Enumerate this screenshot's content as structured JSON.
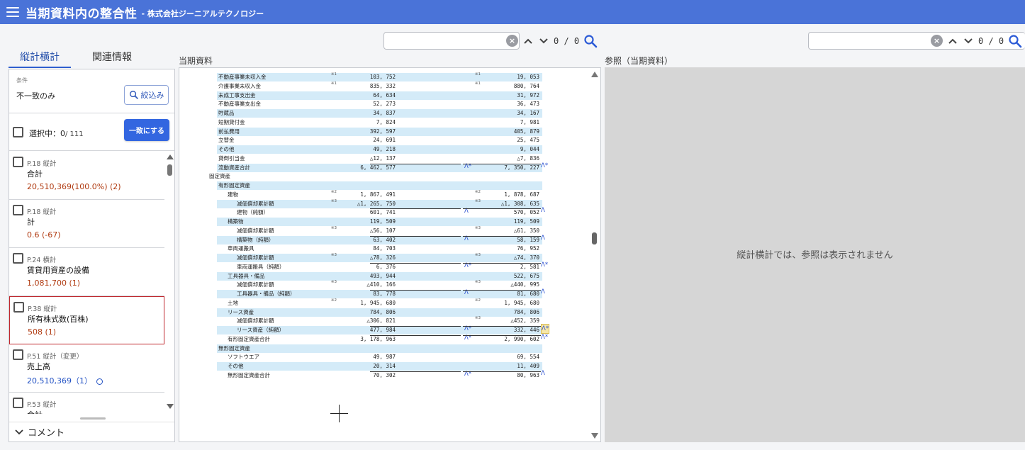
{
  "header": {
    "app_title": "当期資料内の整合性",
    "company": "- 株式会社ジーニアルテクノロジー"
  },
  "search_left": {
    "value": "",
    "count": "0 / 0"
  },
  "search_right": {
    "value": "",
    "count": "0 / 0"
  },
  "tabs": [
    {
      "label": "縦計横計",
      "active": true
    },
    {
      "label": "関連情報",
      "active": false
    }
  ],
  "filter": {
    "condition_label": "条件",
    "condition_value": "不一致のみ",
    "button_label": "絞込み"
  },
  "selection": {
    "label": "選択中：",
    "selected": "0",
    "total": "/ 111",
    "match_button": "一致にする"
  },
  "items": [
    {
      "page": "P.18 縦計",
      "name": "合計",
      "value": "20,510,369(100.0%) (2)",
      "color": "#b03a10"
    },
    {
      "page": "P.18 縦計",
      "name": "計",
      "value": "0.6 (-67)",
      "color": "#b03a10"
    },
    {
      "page": "P.24 横計",
      "name": "賃貸用資産の設備",
      "value": "1,081,700 (1)",
      "color": "#b03a10"
    },
    {
      "page": "P.38 縦計",
      "name": "所有株式数(百株)",
      "value": "508 (1)",
      "color": "#b03a10"
    },
    {
      "page": "P.51 縦計（変更）",
      "name": "売上高",
      "value": "20,510,369（1）",
      "color": "#2352c4"
    },
    {
      "page": "P.53 縦計",
      "name": "合計",
      "value": "",
      "color": "#b03a10"
    }
  ],
  "comment_label": "コメント",
  "doc_pane": {
    "label": "当期資料"
  },
  "ref_pane": {
    "label": "参照（当期資料）",
    "message": "縦計横計では、参照は表示されません"
  },
  "doc_rows": [
    {
      "label": "不動産事業未収入金",
      "indent": 0,
      "v1": "103, 752",
      "v2": "19, 053",
      "note1": "※1",
      "note2": "※1",
      "shade": true
    },
    {
      "label": "介護事業未収入金",
      "indent": 0,
      "v1": "835, 332",
      "v2": "880, 764",
      "note1": "※1",
      "note2": "※1",
      "shade": false
    },
    {
      "label": "未成工事支出金",
      "indent": 0,
      "v1": "64, 634",
      "v2": "31, 972",
      "shade": true
    },
    {
      "label": "不動産事業支出金",
      "indent": 0,
      "v1": "52, 273",
      "v2": "36, 473",
      "shade": false
    },
    {
      "label": "貯蔵品",
      "indent": 0,
      "v1": "34, 837",
      "v2": "34, 167",
      "shade": true
    },
    {
      "label": "短期貸付金",
      "indent": 0,
      "v1": "7, 824",
      "v2": "7, 981",
      "shade": false
    },
    {
      "label": "前払費用",
      "indent": 0,
      "v1": "392, 597",
      "v2": "405, 879",
      "shade": true
    },
    {
      "label": "立替金",
      "indent": 0,
      "v1": "24, 691",
      "v2": "25, 475",
      "shade": false
    },
    {
      "label": "その他",
      "indent": 0,
      "v1": "49, 218",
      "v2": "9, 044",
      "shade": true
    },
    {
      "label": "貸倒引当金",
      "indent": 0,
      "v1": "△12, 137",
      "v2": "△7, 836",
      "shade": false
    },
    {
      "label": "流動資産合計",
      "indent": 0,
      "v1": "6, 462, 577",
      "v2": "7, 350, 227",
      "m1": "Λ*",
      "m2": "Λ*",
      "shade": true
    },
    {
      "label": "固定資産",
      "indent": -1,
      "v1": "",
      "v2": "",
      "shade": false
    },
    {
      "label": "有形固定資産",
      "indent": 0,
      "v1": "",
      "v2": "",
      "shade": true
    },
    {
      "label": "建物",
      "indent": 1,
      "v1": "1, 867, 491",
      "v2": "1, 878, 687",
      "note1": "※2",
      "note2": "※2",
      "shade": false
    },
    {
      "label": "減価償却累計額",
      "indent": 2,
      "v1": "△1, 265, 750",
      "v2": "△1, 308, 635",
      "note1": "※3",
      "note2": "※3",
      "shade": true
    },
    {
      "label": "建物（純額）",
      "indent": 2,
      "v1": "601, 741",
      "v2": "570, 052",
      "m1": "Λ",
      "m2": "Λ",
      "shade": false
    },
    {
      "label": "構築物",
      "indent": 1,
      "v1": "119, 509",
      "v2": "119, 509",
      "shade": true
    },
    {
      "label": "減価償却累計額",
      "indent": 2,
      "v1": "△56, 107",
      "v2": "△61, 350",
      "note1": "※3",
      "note2": "※3",
      "shade": false
    },
    {
      "label": "構築物（純額）",
      "indent": 2,
      "v1": "63, 402",
      "v2": "58, 159",
      "m1": "Λ",
      "m2": "Λ",
      "shade": true
    },
    {
      "label": "車両運搬具",
      "indent": 1,
      "v1": "84, 703",
      "v2": "76, 952",
      "shade": false
    },
    {
      "label": "減価償却累計額",
      "indent": 2,
      "v1": "△78, 326",
      "v2": "△74, 370",
      "note1": "※3",
      "note2": "※3",
      "shade": true
    },
    {
      "label": "車両運搬具（純額）",
      "indent": 2,
      "v1": "6, 376",
      "v2": "2, 581",
      "m1": "Λ*",
      "m2": "Λ*",
      "shade": false
    },
    {
      "label": "工具器具・備品",
      "indent": 1,
      "v1": "493, 944",
      "v2": "522, 675",
      "shade": true
    },
    {
      "label": "減価償却累計額",
      "indent": 2,
      "v1": "△410, 166",
      "v2": "△440, 995",
      "note1": "※3",
      "note2": "※3",
      "shade": false
    },
    {
      "label": "工具器具・備品（純額）",
      "indent": 2,
      "v1": "83, 778",
      "v2": "81, 680",
      "m1": "Λ",
      "m2": "Λ",
      "shade": true
    },
    {
      "label": "土地",
      "indent": 1,
      "v1": "1, 945, 680",
      "v2": "1, 945, 680",
      "note1": "※2",
      "note2": "※2",
      "shade": false
    },
    {
      "label": "リース資産",
      "indent": 1,
      "v1": "784, 806",
      "v2": "784, 806",
      "shade": true
    },
    {
      "label": "減価償却累計額",
      "indent": 2,
      "v1": "△306, 821",
      "v2": "△452, 359",
      "note2": "※3",
      "shade": false
    },
    {
      "label": "リース資産（純額）",
      "indent": 2,
      "v1": "477, 984",
      "v2": "332, 446",
      "m1": "Λ*",
      "m2": "Λ*",
      "m2boxed": true,
      "shade": true
    },
    {
      "label": "有形固定資産合計",
      "indent": 1,
      "v1": "3, 178, 963",
      "v2": "2, 990, 602",
      "m1": "Λ*",
      "m2": "Λ*",
      "shade": false
    },
    {
      "label": "無形固定資産",
      "indent": 0,
      "v1": "",
      "v2": "",
      "shade": true
    },
    {
      "label": "ソフトウエア",
      "indent": 1,
      "v1": "49, 987",
      "v2": "69, 554",
      "shade": false
    },
    {
      "label": "その他",
      "indent": 1,
      "v1": "20, 314",
      "v2": "11, 409",
      "shade": true
    },
    {
      "label": "無形固定資産合計",
      "indent": 1,
      "v1": "70, 302",
      "v2": "80, 963",
      "m1": "Λ*",
      "m2": "Λ",
      "shade": false
    }
  ]
}
